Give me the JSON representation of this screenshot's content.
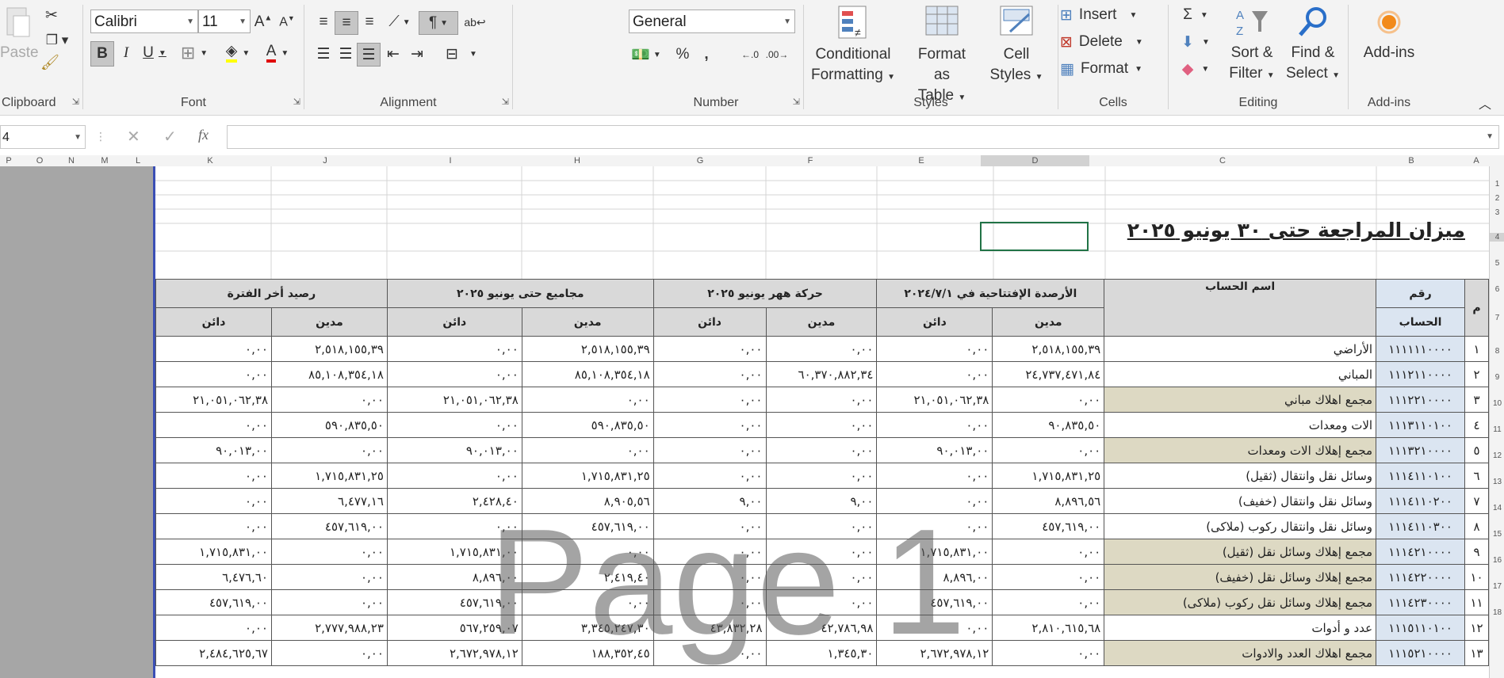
{
  "ribbon": {
    "clipboard": {
      "label": "Clipboard",
      "paste": "Paste"
    },
    "font": {
      "label": "Font",
      "name": "Calibri",
      "size": "11",
      "bold": "B",
      "italic": "I",
      "underline": "U"
    },
    "alignment": {
      "label": "Alignment"
    },
    "number": {
      "label": "Number",
      "format": "General",
      "percent": "%",
      "comma": ","
    },
    "styles": {
      "label": "Styles",
      "conditional": "Conditional",
      "conditional2": "Formatting",
      "format_table": "Format as",
      "format_table2": "Table",
      "cell_styles": "Cell",
      "cell_styles2": "Styles"
    },
    "cells": {
      "label": "Cells",
      "insert": "Insert",
      "delete": "Delete",
      "format": "Format"
    },
    "editing": {
      "label": "Editing",
      "sort": "Sort &",
      "sort2": "Filter",
      "find": "Find &",
      "find2": "Select"
    },
    "addins": {
      "label": "Add-ins",
      "button": "Add-ins"
    }
  },
  "formula_bar": {
    "name_box": "4",
    "fx": "fx",
    "content": ""
  },
  "columns": [
    "P",
    "O",
    "N",
    "M",
    "L",
    "K",
    "J",
    "I",
    "H",
    "G",
    "F",
    "E",
    "D",
    "C",
    "B",
    "A"
  ],
  "rows": [
    "1",
    "2",
    "3",
    "4",
    "5",
    "6",
    "7",
    "8",
    "9",
    "10",
    "11",
    "12",
    "13",
    "14",
    "15",
    "16",
    "17",
    "18"
  ],
  "sheet": {
    "title": "ميزان المراجعة حتى ٣٠ يونيو ٢٠٢٥",
    "headers": {
      "m": "م",
      "acc1": "رقم",
      "acc2": "الحساب",
      "name": "اسم الحساب",
      "opening": "الأرصدة الإفتتاحية في ٢٠٢٤/٧/١",
      "movement": "حركة ههر يونيو ٢٠٢٥",
      "totals": "مجاميع حتى يونيو ٢٠٢٥",
      "balance": "رصيد أخر الفترة",
      "debit": "مدين",
      "credit": "دائن"
    },
    "rows": [
      [
        "١",
        "١١١١١١٠٠٠٠",
        "الأراضي",
        "٢,٥١٨,١٥٥,٣٩",
        "٠,٠٠",
        "٠,٠٠",
        "٠,٠٠",
        "٢,٥١٨,١٥٥,٣٩",
        "٠,٠٠",
        "٢,٥١٨,١٥٥,٣٩",
        "٠,٠٠",
        false
      ],
      [
        "٢",
        "١١١٢١١٠٠٠٠",
        "المباني",
        "٢٤,٧٣٧,٤٧١,٨٤",
        "٠,٠٠",
        "٦٠,٣٧٠,٨٨٢,٣٤",
        "٠,٠٠",
        "٨٥,١٠٨,٣٥٤,١٨",
        "٠,٠٠",
        "٨٥,١٠٨,٣٥٤,١٨",
        "٠,٠٠",
        false
      ],
      [
        "٣",
        "١١١٢٢١٠٠٠٠",
        "مجمع اهلاك مباني",
        "٠,٠٠",
        "٢١,٠٥١,٠٦٢,٣٨",
        "٠,٠٠",
        "٠,٠٠",
        "٠,٠٠",
        "٢١,٠٥١,٠٦٢,٣٨",
        "٠,٠٠",
        "٢١,٠٥١,٠٦٢,٣٨",
        true
      ],
      [
        "٤",
        "١١١٣١١٠١٠٠",
        "الات ومعدات",
        "٩٠,٨٣٥,٥٠",
        "٠,٠٠",
        "٠,٠٠",
        "٠,٠٠",
        "٥٩٠,٨٣٥,٥٠",
        "٠,٠٠",
        "٥٩٠,٨٣٥,٥٠",
        "٠,٠٠",
        false
      ],
      [
        "٥",
        "١١١٣٢١٠٠٠٠",
        "مجمع إهلاك الات ومعدات",
        "٠,٠٠",
        "٩٠,٠١٣,٠٠",
        "٠,٠٠",
        "٠,٠٠",
        "٠,٠٠",
        "٩٠,٠١٣,٠٠",
        "٠,٠٠",
        "٩٠,٠١٣,٠٠",
        true
      ],
      [
        "٦",
        "١١١٤١١٠١٠٠",
        "وسائل نقل وانتقال (ثقيل)",
        "١,٧١٥,٨٣١,٢٥",
        "٠,٠٠",
        "٠,٠٠",
        "٠,٠٠",
        "١,٧١٥,٨٣١,٢٥",
        "٠,٠٠",
        "١,٧١٥,٨٣١,٢٥",
        "٠,٠٠",
        false
      ],
      [
        "٧",
        "١١١٤١١٠٢٠٠",
        "وسائل نقل وانتقال (خفيف)",
        "٨,٨٩٦,٥٦",
        "٠,٠٠",
        "٩,٠٠",
        "٩,٠٠",
        "٨,٩٠٥,٥٦",
        "٢,٤٢٨,٤٠",
        "٦,٤٧٧,١٦",
        "٠,٠٠",
        false
      ],
      [
        "٨",
        "١١١٤١١٠٣٠٠",
        "وسائل نقل وانتقال ركوب (ملاكى)",
        "٤٥٧,٦١٩,٠٠",
        "٠,٠٠",
        "٠,٠٠",
        "٠,٠٠",
        "٤٥٧,٦١٩,٠٠",
        "٠,٠٠",
        "٤٥٧,٦١٩,٠٠",
        "٠,٠٠",
        false
      ],
      [
        "٩",
        "١١١٤٢١٠٠٠٠",
        "مجمع إهلاك وسائل نقل (ثقيل)",
        "٠,٠٠",
        "١,٧١٥,٨٣١,٠٠",
        "٠,٠٠",
        "٠,٠٠",
        "٠,٠٠",
        "١,٧١٥,٨٣١,٠٠",
        "٠,٠٠",
        "١,٧١٥,٨٣١,٠٠",
        true
      ],
      [
        "١٠",
        "١١١٤٢٢٠٠٠٠",
        "مجمع إهلاك وسائل نقل (خفيف)",
        "٠,٠٠",
        "٨,٨٩٦,٠٠",
        "٠,٠٠",
        "٠,٠٠",
        "٢,٤١٩,٤٠",
        "٨,٨٩٦,٠٠",
        "٠,٠٠",
        "٦,٤٧٦,٦٠",
        true
      ],
      [
        "١١",
        "١١١٤٢٣٠٠٠٠",
        "مجمع إهلاك وسائل نقل ركوب (ملاكى)",
        "٠,٠٠",
        "٤٥٧,٦١٩,٠٠",
        "٠,٠٠",
        "٠,٠٠",
        "٠,٠٠",
        "٤٥٧,٦١٩,٠٠",
        "٠,٠٠",
        "٤٥٧,٦١٩,٠٠",
        true
      ],
      [
        "١٢",
        "١١١٥١١٠١٠٠",
        "عدد و أدوات",
        "٢,٨١٠,٦١٥,٦٨",
        "٠,٠٠",
        "٤٢,٧٨٦,٩٨",
        "٤٣,٨٣٢,٢٨",
        "٣,٣٤٥,٢٤٧,٣٠",
        "٥٦٧,٢٥٩,٠٧",
        "٢,٧٧٧,٩٨٨,٢٣",
        "٠,٠٠",
        false
      ],
      [
        "١٣",
        "١١١٥٢١٠٠٠٠",
        "مجمع اهلاك العدد والادوات",
        "٠,٠٠",
        "٢,٦٧٢,٩٧٨,١٢",
        "١,٣٤٥,٣٠",
        "٠,٠٠",
        "١٨٨,٣٥٢,٤٥",
        "٢,٦٧٢,٩٧٨,١٢",
        "٠,٠٠",
        "٢,٤٨٤,٦٢٥,٦٧",
        true
      ]
    ]
  },
  "watermark": "Page 1"
}
